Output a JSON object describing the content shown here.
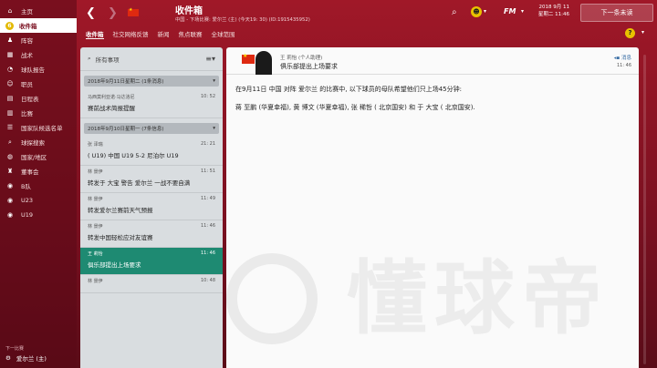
{
  "sidebar": {
    "items": [
      {
        "label": "主页",
        "icon": "home-icon",
        "glyph": "⌂"
      },
      {
        "label": "收件箱",
        "icon": "inbox-icon",
        "badge": "6"
      },
      {
        "label": "阵容",
        "icon": "squad-icon",
        "glyph": "♟"
      },
      {
        "label": "战术",
        "icon": "tactics-icon",
        "glyph": "▦"
      },
      {
        "label": "球队报告",
        "icon": "report-icon",
        "glyph": "◔"
      },
      {
        "label": "职员",
        "icon": "staff-icon",
        "glyph": "☺"
      },
      {
        "label": "日程表",
        "icon": "calendar-icon",
        "glyph": "▤"
      },
      {
        "label": "比赛",
        "icon": "match-icon",
        "glyph": "▥"
      },
      {
        "label": "国家队候选名单",
        "icon": "shortlist-icon",
        "glyph": "☰"
      },
      {
        "label": "球探搜索",
        "icon": "scouting-icon",
        "glyph": "⌕"
      },
      {
        "label": "国家/地区",
        "icon": "nation-icon",
        "glyph": "◍"
      },
      {
        "label": "董事会",
        "icon": "board-icon",
        "glyph": "♜"
      },
      {
        "label": "B队",
        "icon": "b-team-icon",
        "glyph": "◉"
      },
      {
        "label": "U23",
        "icon": "u23-icon",
        "glyph": "◉"
      },
      {
        "label": "U19",
        "icon": "u19-icon",
        "glyph": "◉"
      }
    ],
    "next_label": "下一比赛",
    "next_match": "爱尔兰 (主)"
  },
  "topbar": {
    "title": "收件箱",
    "subtitle": "中国 - 下场比赛: 爱尔兰 (主) (今天19: 30) (ID:1915435952)",
    "date_line1": "2018 9月 11",
    "date_line2": "星期二 11:46",
    "continue_label": "下一条未读",
    "fm_label": "FM"
  },
  "tabs": [
    "收件箱",
    "社交网络反馈",
    "新闻",
    "焦点联赛",
    "全球范围"
  ],
  "list": {
    "header": "所有事项",
    "groups": [
      {
        "header": "2018年9月11日星期二 (1条消息)",
        "messages": [
          {
            "from": "马西莫利亚诺·马达洛尼",
            "time": "10: 52",
            "subject": "赛前战术简报提醒",
            "selected": false
          }
        ]
      },
      {
        "header": "2018年9月10日星期一 (7条信息)",
        "messages": [
          {
            "from": "张 泽瑞",
            "time": "21: 21",
            "subject": "( U19) 中国 U19 5-2 尼泊尔 U19",
            "selected": false
          },
          {
            "from": "林 景伊",
            "time": "11: 51",
            "subject": "转发于 大宝 警告 爱尔兰 一战不要自满",
            "selected": false
          },
          {
            "from": "林 景伊",
            "time": "11: 49",
            "subject": "转发爱尔兰赛前天气预报",
            "selected": false
          },
          {
            "from": "林 景伊",
            "time": "11: 46",
            "subject": "转发中国轻松应对友谊赛",
            "selected": false
          },
          {
            "from": "王 莉怡",
            "time": "11: 46",
            "subject": "俱乐部提出上场要求",
            "selected": true
          },
          {
            "from": "林 景伊",
            "time": "10: 48",
            "subject": "",
            "selected": false
          }
        ]
      }
    ]
  },
  "reader": {
    "sender": "王 莉怡 (个人助理)",
    "subject": "俱乐部提出上场要求",
    "tag": "消息",
    "time": "11: 46",
    "paragraphs": [
      "在9月11日 中国 对阵 爱尔兰 的比赛中, 以下球员的母队希望他们只上场45分钟:",
      "蒋 至鹏 (华夏幸福), 黄 博文 (华夏幸福), 张 稀哲 ( 北京国安) 和 于 大宝 ( 北京国安)."
    ],
    "watermark": "懂球帝"
  },
  "colors": {
    "accent": "#7a1020",
    "selected": "#1e8a72",
    "badge": "#e3b900"
  }
}
